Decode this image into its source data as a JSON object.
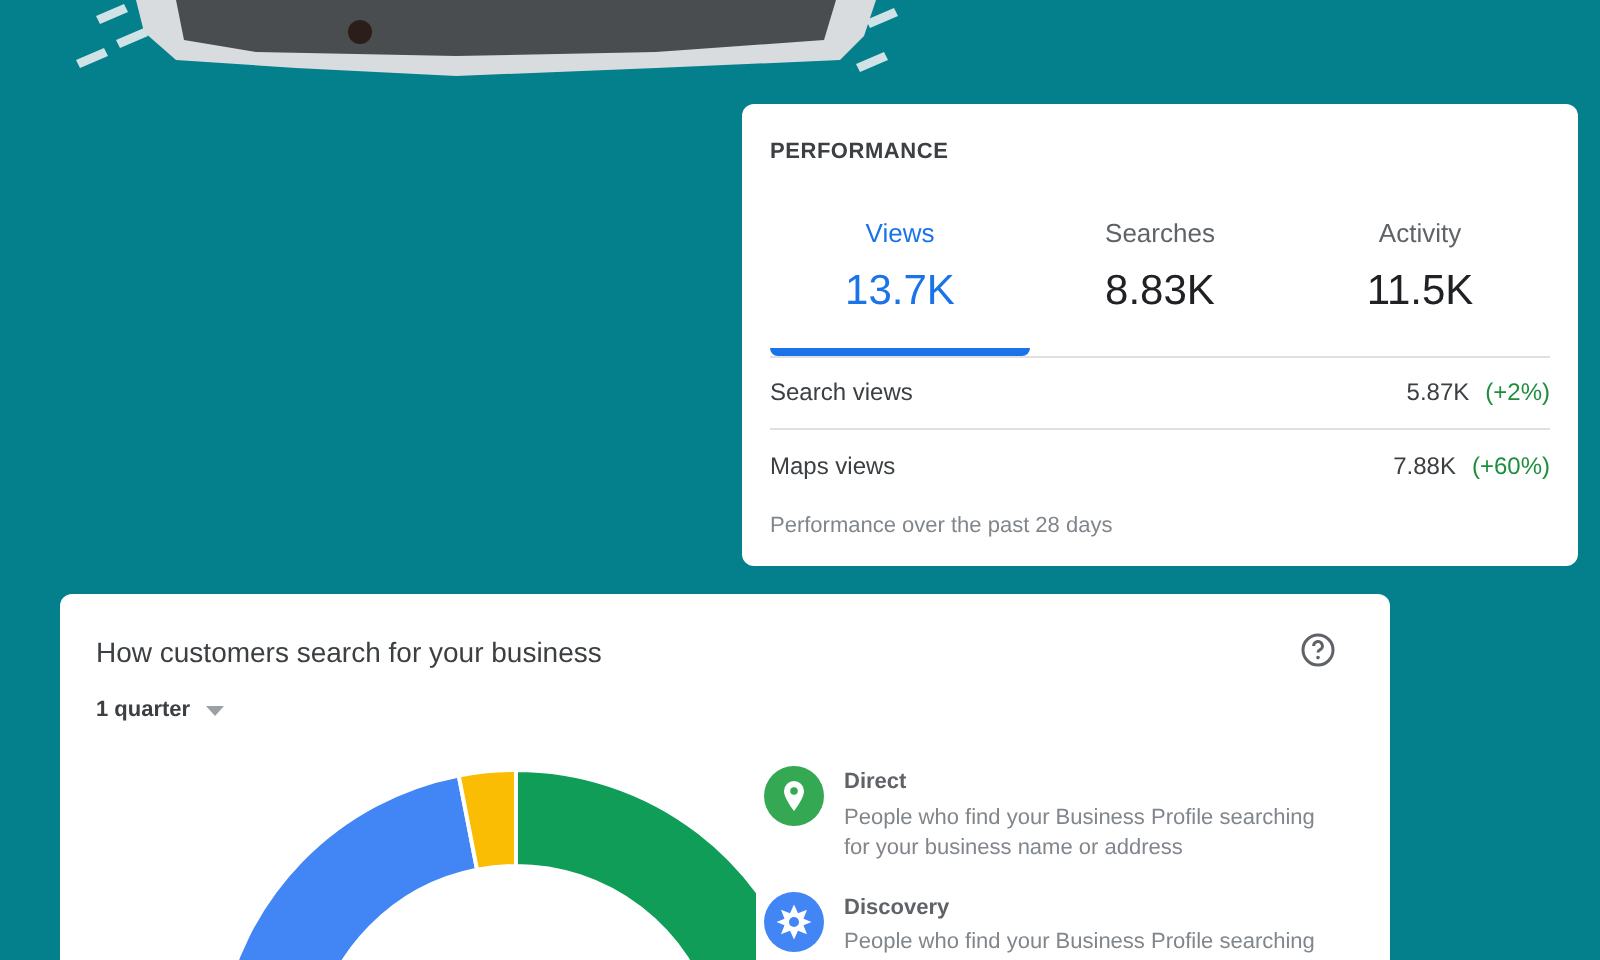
{
  "performance": {
    "title": "PERFORMANCE",
    "tabs": [
      {
        "label": "Views",
        "value": "13.7K",
        "selected": true
      },
      {
        "label": "Searches",
        "value": "8.83K",
        "selected": false
      },
      {
        "label": "Activity",
        "value": "11.5K",
        "selected": false
      }
    ],
    "rows": [
      {
        "label": "Search views",
        "value": "5.87K",
        "change": "(+2%)"
      },
      {
        "label": "Maps views",
        "value": "7.88K",
        "change": "(+60%)"
      }
    ],
    "footnote": "Performance over the past 28 days"
  },
  "search_card": {
    "title": "How customers search for your business",
    "period": "1 quarter",
    "legend": [
      {
        "kind": "pin",
        "name": "Direct",
        "description": "People who find your Business Profile searching for your business name or address",
        "color": "#34a853"
      },
      {
        "kind": "compass",
        "name": "Discovery",
        "description": "People who find your Business Profile searching",
        "color": "#4285f4"
      }
    ]
  }
}
